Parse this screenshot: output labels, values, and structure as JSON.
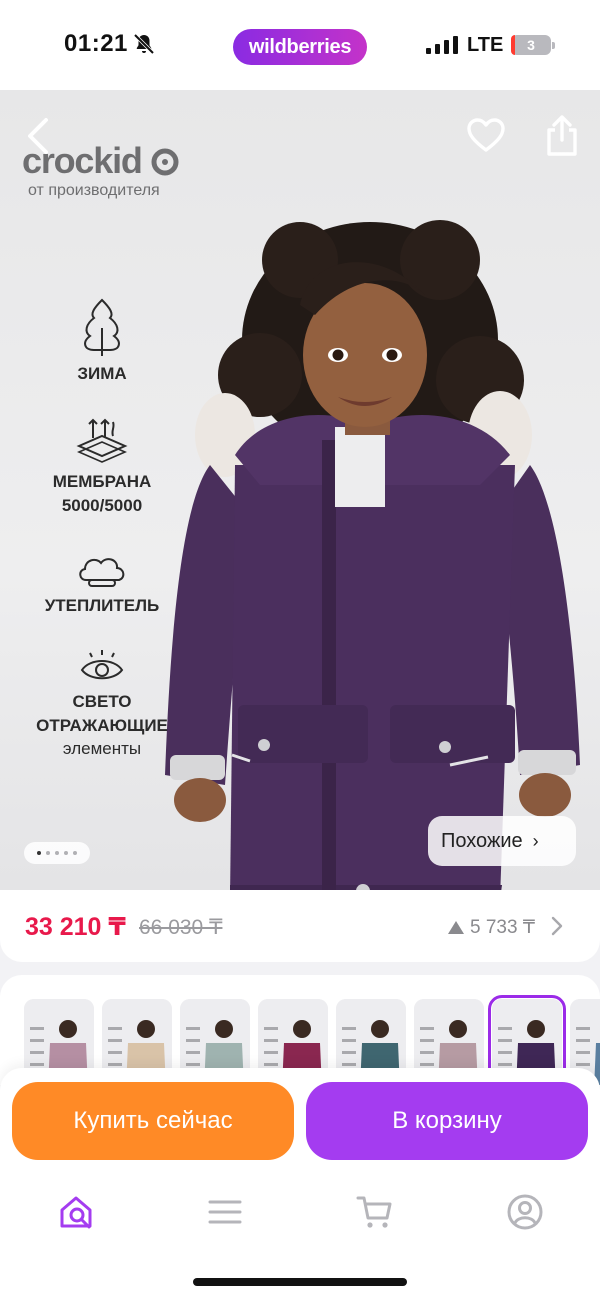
{
  "status_bar": {
    "time": "01:21",
    "app_badge": "wildberries",
    "network": "LTE",
    "battery": "3",
    "icons": [
      "bell-muted-icon",
      "signal-icon",
      "battery-icon"
    ]
  },
  "hero": {
    "brand": "crockid",
    "brand_sub": "от производителя",
    "features": [
      {
        "icon": "fir-tree-icon",
        "label": "ЗИМА",
        "sub": ""
      },
      {
        "icon": "membrane-icon",
        "label": "МЕМБРАНА\n5000/5000",
        "sub": ""
      },
      {
        "icon": "clouds-icon",
        "label": "УТЕПЛИТЕЛЬ",
        "sub": ""
      },
      {
        "icon": "eye-icon",
        "label": "СВЕТО\nОТРАЖАЮЩИЕ",
        "sub": "элементы"
      }
    ],
    "similar_label": "Похожие",
    "similar_chevron": "›",
    "image_dots": 5,
    "active_dot": 0
  },
  "price": {
    "current": "33 210 ₸",
    "old": "66 030 ₸",
    "difference": "5 733 ₸"
  },
  "thumbnails": {
    "count": 8,
    "selected_index": 6,
    "colors": [
      "#b58fa3",
      "#d9c3a8",
      "#9fb3b0",
      "#8a2750",
      "#3f6670",
      "#b69ba3",
      "#3f2756",
      "#5a7fa0"
    ]
  },
  "actions": {
    "buy_now": "Купить сейчас",
    "add_to_cart": "В корзину"
  },
  "tab_bar": {
    "items": [
      "home-search-icon",
      "menu-icon",
      "cart-icon",
      "profile-icon"
    ],
    "active_index": 0
  },
  "colors": {
    "accent": "#a43cf0",
    "buy": "#ff8a26",
    "price": "#e8194b"
  }
}
